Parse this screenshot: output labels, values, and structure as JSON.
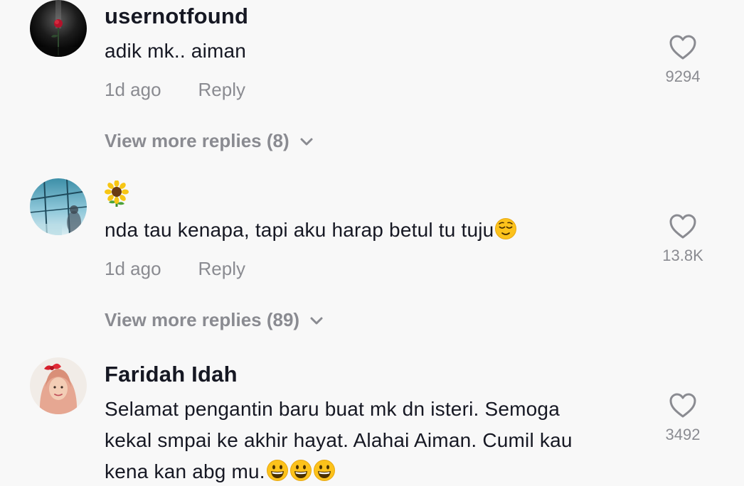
{
  "comments": [
    {
      "username": "usernotfound",
      "text": "adik mk.. aiman",
      "time": "1d ago",
      "reply_label": "Reply",
      "likes": "9294",
      "view_replies": "View more replies (8)",
      "avatar_icon": "rose-in-dark-avatar"
    },
    {
      "username_emoji": "sunflower-emoji",
      "text": "nda tau kenapa, tapi aku harap betul tu tuju",
      "text_emoji": "relieved-face-emoji",
      "time": "1d ago",
      "reply_label": "Reply",
      "likes": "13.8K",
      "view_replies": "View more replies (89)",
      "avatar_icon": "window-scenery-avatar"
    },
    {
      "username": "Faridah Idah",
      "text_lines": [
        "Selamat pengantin baru buat mk dn isteri. Semoga",
        "kekal smpai ke akhir hayat. Alahai Aiman. Cumil kau",
        "kena kan abg mu."
      ],
      "text_emoji": "grinning-face-emoji",
      "likes": "3492",
      "avatar_icon": "hijab-woman-avatar"
    }
  ],
  "colors": {
    "background": "#f8f8f8",
    "primary_text": "#161823",
    "secondary_text": "#8a8b91"
  }
}
